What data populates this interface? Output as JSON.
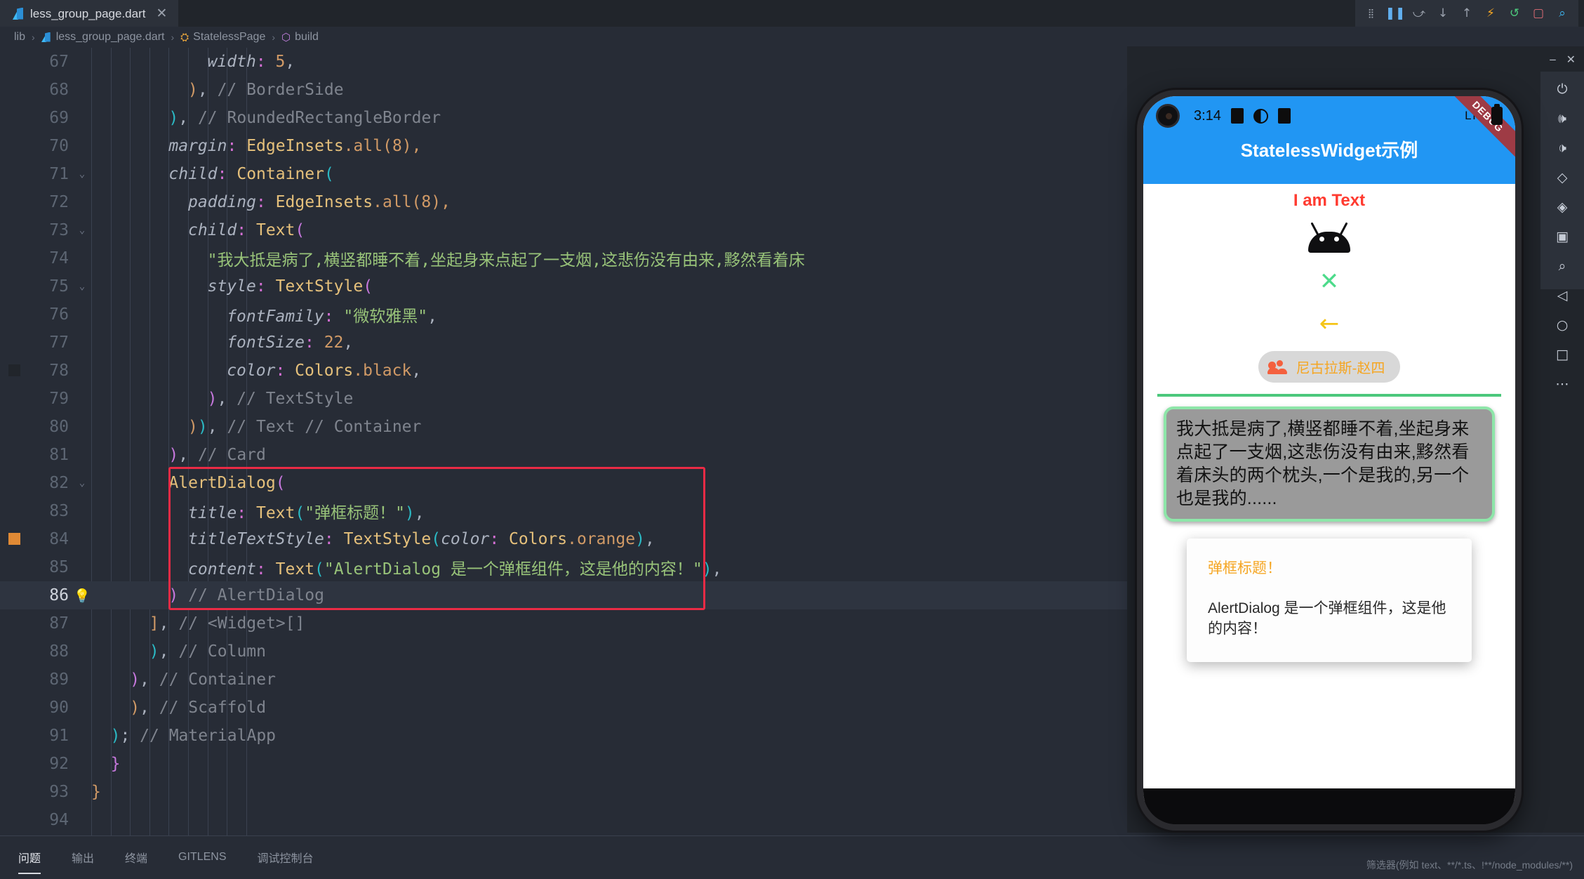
{
  "window": {
    "tab": {
      "label": "less_group_page.dart",
      "icon": "dart-file-icon",
      "close": "✕"
    },
    "toolbar_icons": [
      "grip-icon",
      "pause-icon",
      "step-over-icon",
      "step-into-icon",
      "step-out-icon",
      "hot-reload-icon",
      "restart-icon",
      "stop-icon",
      "inspector-icon"
    ]
  },
  "breadcrumb": {
    "items": [
      {
        "label": "lib",
        "icon": ""
      },
      {
        "label": "less_group_page.dart",
        "icon": "dart-file-icon"
      },
      {
        "label": "StatelessPage",
        "icon": "class-icon"
      },
      {
        "label": "build",
        "icon": "method-icon"
      }
    ],
    "separator": "›"
  },
  "editor": {
    "lines": [
      {
        "num": "67",
        "fold": "",
        "marker": "",
        "indent": 6,
        "tokens": [
          {
            "t": "width",
            "c": "t-prop"
          },
          {
            "t": ":",
            "c": "t-colon"
          },
          {
            "t": " 5",
            "c": "t-num"
          },
          {
            "t": ",",
            "c": "t-plain"
          }
        ]
      },
      {
        "num": "68",
        "fold": "",
        "marker": "",
        "indent": 5,
        "tokens": [
          {
            "t": ")",
            "c": "t-par"
          },
          {
            "t": ", ",
            "c": "t-plain"
          },
          {
            "t": "// BorderSide",
            "c": "t-cmt"
          }
        ]
      },
      {
        "num": "69",
        "fold": "",
        "marker": "",
        "indent": 4,
        "tokens": [
          {
            "t": ")",
            "c": "t-par2"
          },
          {
            "t": ", ",
            "c": "t-plain"
          },
          {
            "t": "// RoundedRectangleBorder",
            "c": "t-cmt"
          }
        ]
      },
      {
        "num": "70",
        "fold": "",
        "marker": "",
        "indent": 4,
        "tokens": [
          {
            "t": "margin",
            "c": "t-prop"
          },
          {
            "t": ":",
            "c": "t-colon"
          },
          {
            "t": " ",
            "c": "t-plain"
          },
          {
            "t": "EdgeInsets",
            "c": "t-cls"
          },
          {
            "t": ".all(",
            "c": "t-par"
          },
          {
            "t": "8",
            "c": "t-num"
          },
          {
            "t": "),",
            "c": "t-par"
          }
        ]
      },
      {
        "num": "71",
        "fold": "⌄",
        "marker": "",
        "indent": 4,
        "tokens": [
          {
            "t": "child",
            "c": "t-prop"
          },
          {
            "t": ":",
            "c": "t-colon"
          },
          {
            "t": " ",
            "c": "t-plain"
          },
          {
            "t": "Container",
            "c": "t-cls"
          },
          {
            "t": "(",
            "c": "t-par2"
          }
        ]
      },
      {
        "num": "72",
        "fold": "",
        "marker": "",
        "indent": 5,
        "tokens": [
          {
            "t": "padding",
            "c": "t-prop"
          },
          {
            "t": ":",
            "c": "t-colon"
          },
          {
            "t": " ",
            "c": "t-plain"
          },
          {
            "t": "EdgeInsets",
            "c": "t-cls"
          },
          {
            "t": ".all(",
            "c": "t-par"
          },
          {
            "t": "8",
            "c": "t-num"
          },
          {
            "t": "),",
            "c": "t-par"
          }
        ]
      },
      {
        "num": "73",
        "fold": "⌄",
        "marker": "",
        "indent": 5,
        "tokens": [
          {
            "t": "child",
            "c": "t-prop"
          },
          {
            "t": ":",
            "c": "t-colon"
          },
          {
            "t": " ",
            "c": "t-plain"
          },
          {
            "t": "Text",
            "c": "t-cls"
          },
          {
            "t": "(",
            "c": "t-par3"
          }
        ]
      },
      {
        "num": "74",
        "fold": "",
        "marker": "",
        "indent": 6,
        "tokens": [
          {
            "t": "\"我大抵是病了,横竖都睡不着,坐起身来点起了一支烟,这悲伤没有由来,黟然看着床",
            "c": "t-str"
          }
        ]
      },
      {
        "num": "75",
        "fold": "⌄",
        "marker": "",
        "indent": 6,
        "tokens": [
          {
            "t": "style",
            "c": "t-prop"
          },
          {
            "t": ":",
            "c": "t-colon"
          },
          {
            "t": " ",
            "c": "t-plain"
          },
          {
            "t": "TextStyle",
            "c": "t-cls"
          },
          {
            "t": "(",
            "c": "t-par3"
          }
        ]
      },
      {
        "num": "76",
        "fold": "",
        "marker": "",
        "indent": 7,
        "tokens": [
          {
            "t": "fontFamily",
            "c": "t-prop"
          },
          {
            "t": ":",
            "c": "t-colon"
          },
          {
            "t": " ",
            "c": "t-plain"
          },
          {
            "t": "\"微软雅黑\"",
            "c": "t-str"
          },
          {
            "t": ",",
            "c": "t-plain"
          }
        ]
      },
      {
        "num": "77",
        "fold": "",
        "marker": "",
        "indent": 7,
        "tokens": [
          {
            "t": "fontSize",
            "c": "t-prop"
          },
          {
            "t": ":",
            "c": "t-colon"
          },
          {
            "t": " ",
            "c": "t-plain"
          },
          {
            "t": "22",
            "c": "t-num"
          },
          {
            "t": ",",
            "c": "t-plain"
          }
        ]
      },
      {
        "num": "78",
        "fold": "",
        "marker": "sq-dark",
        "indent": 7,
        "tokens": [
          {
            "t": "color",
            "c": "t-prop"
          },
          {
            "t": ":",
            "c": "t-colon"
          },
          {
            "t": " ",
            "c": "t-plain"
          },
          {
            "t": "Colors",
            "c": "t-cls"
          },
          {
            "t": ".black",
            "c": "t-id"
          },
          {
            "t": ",",
            "c": "t-plain"
          }
        ]
      },
      {
        "num": "79",
        "fold": "",
        "marker": "",
        "indent": 6,
        "tokens": [
          {
            "t": ")",
            "c": "t-par3"
          },
          {
            "t": ", ",
            "c": "t-plain"
          },
          {
            "t": "// TextStyle",
            "c": "t-cmt"
          }
        ]
      },
      {
        "num": "80",
        "fold": "",
        "marker": "",
        "indent": 5,
        "tokens": [
          {
            "t": ")",
            "c": "t-par"
          },
          {
            "t": ")",
            "c": "t-par2"
          },
          {
            "t": ", ",
            "c": "t-plain"
          },
          {
            "t": "// Text // Container",
            "c": "t-cmt"
          }
        ]
      },
      {
        "num": "81",
        "fold": "",
        "marker": "",
        "indent": 4,
        "tokens": [
          {
            "t": ")",
            "c": "t-par3"
          },
          {
            "t": ", ",
            "c": "t-plain"
          },
          {
            "t": "// Card",
            "c": "t-cmt"
          }
        ]
      },
      {
        "num": "82",
        "fold": "⌄",
        "marker": "",
        "indent": 4,
        "tokens": [
          {
            "t": "AlertDialog",
            "c": "t-cls"
          },
          {
            "t": "(",
            "c": "t-par3"
          }
        ]
      },
      {
        "num": "83",
        "fold": "",
        "marker": "",
        "indent": 5,
        "tokens": [
          {
            "t": "title",
            "c": "t-prop"
          },
          {
            "t": ":",
            "c": "t-colon"
          },
          {
            "t": " ",
            "c": "t-plain"
          },
          {
            "t": "Text",
            "c": "t-cls"
          },
          {
            "t": "(",
            "c": "t-par2"
          },
          {
            "t": "\"弹框标题！\"",
            "c": "t-str"
          },
          {
            "t": ")",
            "c": "t-par2"
          },
          {
            "t": ",",
            "c": "t-plain"
          }
        ]
      },
      {
        "num": "84",
        "fold": "",
        "marker": "sq-orange",
        "indent": 5,
        "tokens": [
          {
            "t": "titleTextStyle",
            "c": "t-prop"
          },
          {
            "t": ":",
            "c": "t-colon"
          },
          {
            "t": " ",
            "c": "t-plain"
          },
          {
            "t": "TextStyle",
            "c": "t-cls"
          },
          {
            "t": "(",
            "c": "t-par2"
          },
          {
            "t": "color",
            "c": "t-prop"
          },
          {
            "t": ":",
            "c": "t-colon"
          },
          {
            "t": " ",
            "c": "t-plain"
          },
          {
            "t": "Colors",
            "c": "t-cls"
          },
          {
            "t": ".orange",
            "c": "t-id"
          },
          {
            "t": ")",
            "c": "t-par2"
          },
          {
            "t": ",",
            "c": "t-plain"
          }
        ]
      },
      {
        "num": "85",
        "fold": "",
        "marker": "",
        "indent": 5,
        "tokens": [
          {
            "t": "content",
            "c": "t-prop"
          },
          {
            "t": ":",
            "c": "t-colon"
          },
          {
            "t": " ",
            "c": "t-plain"
          },
          {
            "t": "Text",
            "c": "t-cls"
          },
          {
            "t": "(",
            "c": "t-par2"
          },
          {
            "t": "\"AlertDialog 是一个弹框组件，这是他的内容！\"",
            "c": "t-str"
          },
          {
            "t": ")",
            "c": "t-par2"
          },
          {
            "t": ",",
            "c": "t-plain"
          }
        ]
      },
      {
        "num": "86",
        "fold": "",
        "marker": "bulb",
        "current": true,
        "indent": 4,
        "tokens": [
          {
            "t": ")",
            "c": "t-par3"
          },
          {
            "t": " ",
            "c": "t-plain"
          },
          {
            "t": "// AlertDialog",
            "c": "t-cmt"
          }
        ]
      },
      {
        "num": "87",
        "fold": "",
        "marker": "",
        "indent": 3,
        "tokens": [
          {
            "t": "]",
            "c": "t-par"
          },
          {
            "t": ", ",
            "c": "t-plain"
          },
          {
            "t": "// <Widget>[]",
            "c": "t-cmt"
          }
        ]
      },
      {
        "num": "88",
        "fold": "",
        "marker": "",
        "indent": 3,
        "tokens": [
          {
            "t": ")",
            "c": "t-par2"
          },
          {
            "t": ", ",
            "c": "t-plain"
          },
          {
            "t": "// Column",
            "c": "t-cmt"
          }
        ]
      },
      {
        "num": "89",
        "fold": "",
        "marker": "",
        "indent": 2,
        "tokens": [
          {
            "t": ")",
            "c": "t-par3"
          },
          {
            "t": ", ",
            "c": "t-plain"
          },
          {
            "t": "// Container",
            "c": "t-cmt"
          }
        ]
      },
      {
        "num": "90",
        "fold": "",
        "marker": "",
        "indent": 2,
        "tokens": [
          {
            "t": ")",
            "c": "t-par"
          },
          {
            "t": ", ",
            "c": "t-plain"
          },
          {
            "t": "// Scaffold",
            "c": "t-cmt"
          }
        ]
      },
      {
        "num": "91",
        "fold": "",
        "marker": "",
        "indent": 1,
        "tokens": [
          {
            "t": ")",
            "c": "t-par2"
          },
          {
            "t": "; ",
            "c": "t-plain"
          },
          {
            "t": "// MaterialApp",
            "c": "t-cmt"
          }
        ]
      },
      {
        "num": "92",
        "fold": "",
        "marker": "",
        "indent": 1,
        "tokens": [
          {
            "t": "}",
            "c": "t-par3"
          }
        ]
      },
      {
        "num": "93",
        "fold": "",
        "marker": "",
        "indent": 0,
        "tokens": [
          {
            "t": "}",
            "c": "t-par"
          }
        ]
      },
      {
        "num": "94",
        "fold": "",
        "marker": "",
        "indent": 0,
        "tokens": []
      }
    ]
  },
  "bottom_panel": {
    "tabs": [
      "问题",
      "输出",
      "终端",
      "GITLENS",
      "调试控制台"
    ],
    "active_index": 0,
    "filter_placeholder": "筛选器(例如 text、**/*.ts、!**/node_modules/**)"
  },
  "emulator": {
    "titlebar_icons": [
      "minimize-icon",
      "close-icon"
    ],
    "sidebar_icons": [
      "power-icon",
      "volume-up-icon",
      "volume-down-icon",
      "rotate-left-icon",
      "rotate-right-icon",
      "screenshot-icon",
      "zoom-icon",
      "back-icon",
      "home-icon",
      "overview-icon",
      "more-icon"
    ],
    "phone": {
      "status": {
        "time": "3:14",
        "icons": [
          "sim-icon",
          "dnd-icon",
          "sdcard-icon"
        ],
        "network": "LTE",
        "battery": "battery-icon"
      },
      "debug_ribbon": "DEBUG",
      "appbar_title": "StatelessWidget示例",
      "appbar_color": "#2196f3",
      "text_widget": {
        "label": "I am Text",
        "color": "#ff3b30"
      },
      "icons": [
        {
          "name": "android-icon",
          "glyph": "android"
        },
        {
          "name": "close-icon",
          "glyph": "✕",
          "color": "#4ddb8b"
        },
        {
          "name": "arrow-back-icon",
          "glyph": "←",
          "color": "#f5c518"
        }
      ],
      "chip": {
        "label": "尼古拉斯-赵四",
        "icon": "people-icon",
        "label_color": "#f5a623",
        "bg": "#d8d8d8"
      },
      "divider_color": "#4cc87c",
      "card": {
        "text": "我大抵是病了,横竖都睡不着,坐起身来点起了一支烟,这悲伤没有由来,黟然看着床头的两个枕头,一个是我的,另一个也是我的......",
        "bg": "#9a9a9a",
        "border_color": "#8ee6a9"
      },
      "dialog": {
        "title": "弹框标题！",
        "title_color": "#f5a623",
        "content": "AlertDialog 是一个弹框组件，这是他的内容！"
      }
    }
  }
}
